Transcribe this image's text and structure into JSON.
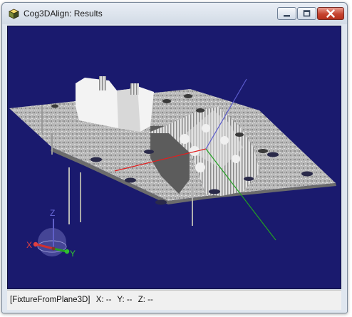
{
  "window": {
    "title": "Cog3DAlign: Results",
    "icon": "cube-app-icon",
    "controls": {
      "minimize": "minimize-icon",
      "maximize": "maximize-icon",
      "close": "close-icon"
    }
  },
  "viewport": {
    "background": "#1a1a6e",
    "point_cloud_color": "#bdbdbd",
    "axis_colors": {
      "x": "#e02020",
      "y": "#22a022",
      "z": "#5a5acc"
    },
    "gizmo_labels": {
      "x": "X",
      "y": "Y",
      "z": "Z"
    }
  },
  "status": {
    "fixture": "[FixtureFromPlane3D]",
    "x": "X: --",
    "y": "Y: --",
    "z": "Z: --"
  }
}
